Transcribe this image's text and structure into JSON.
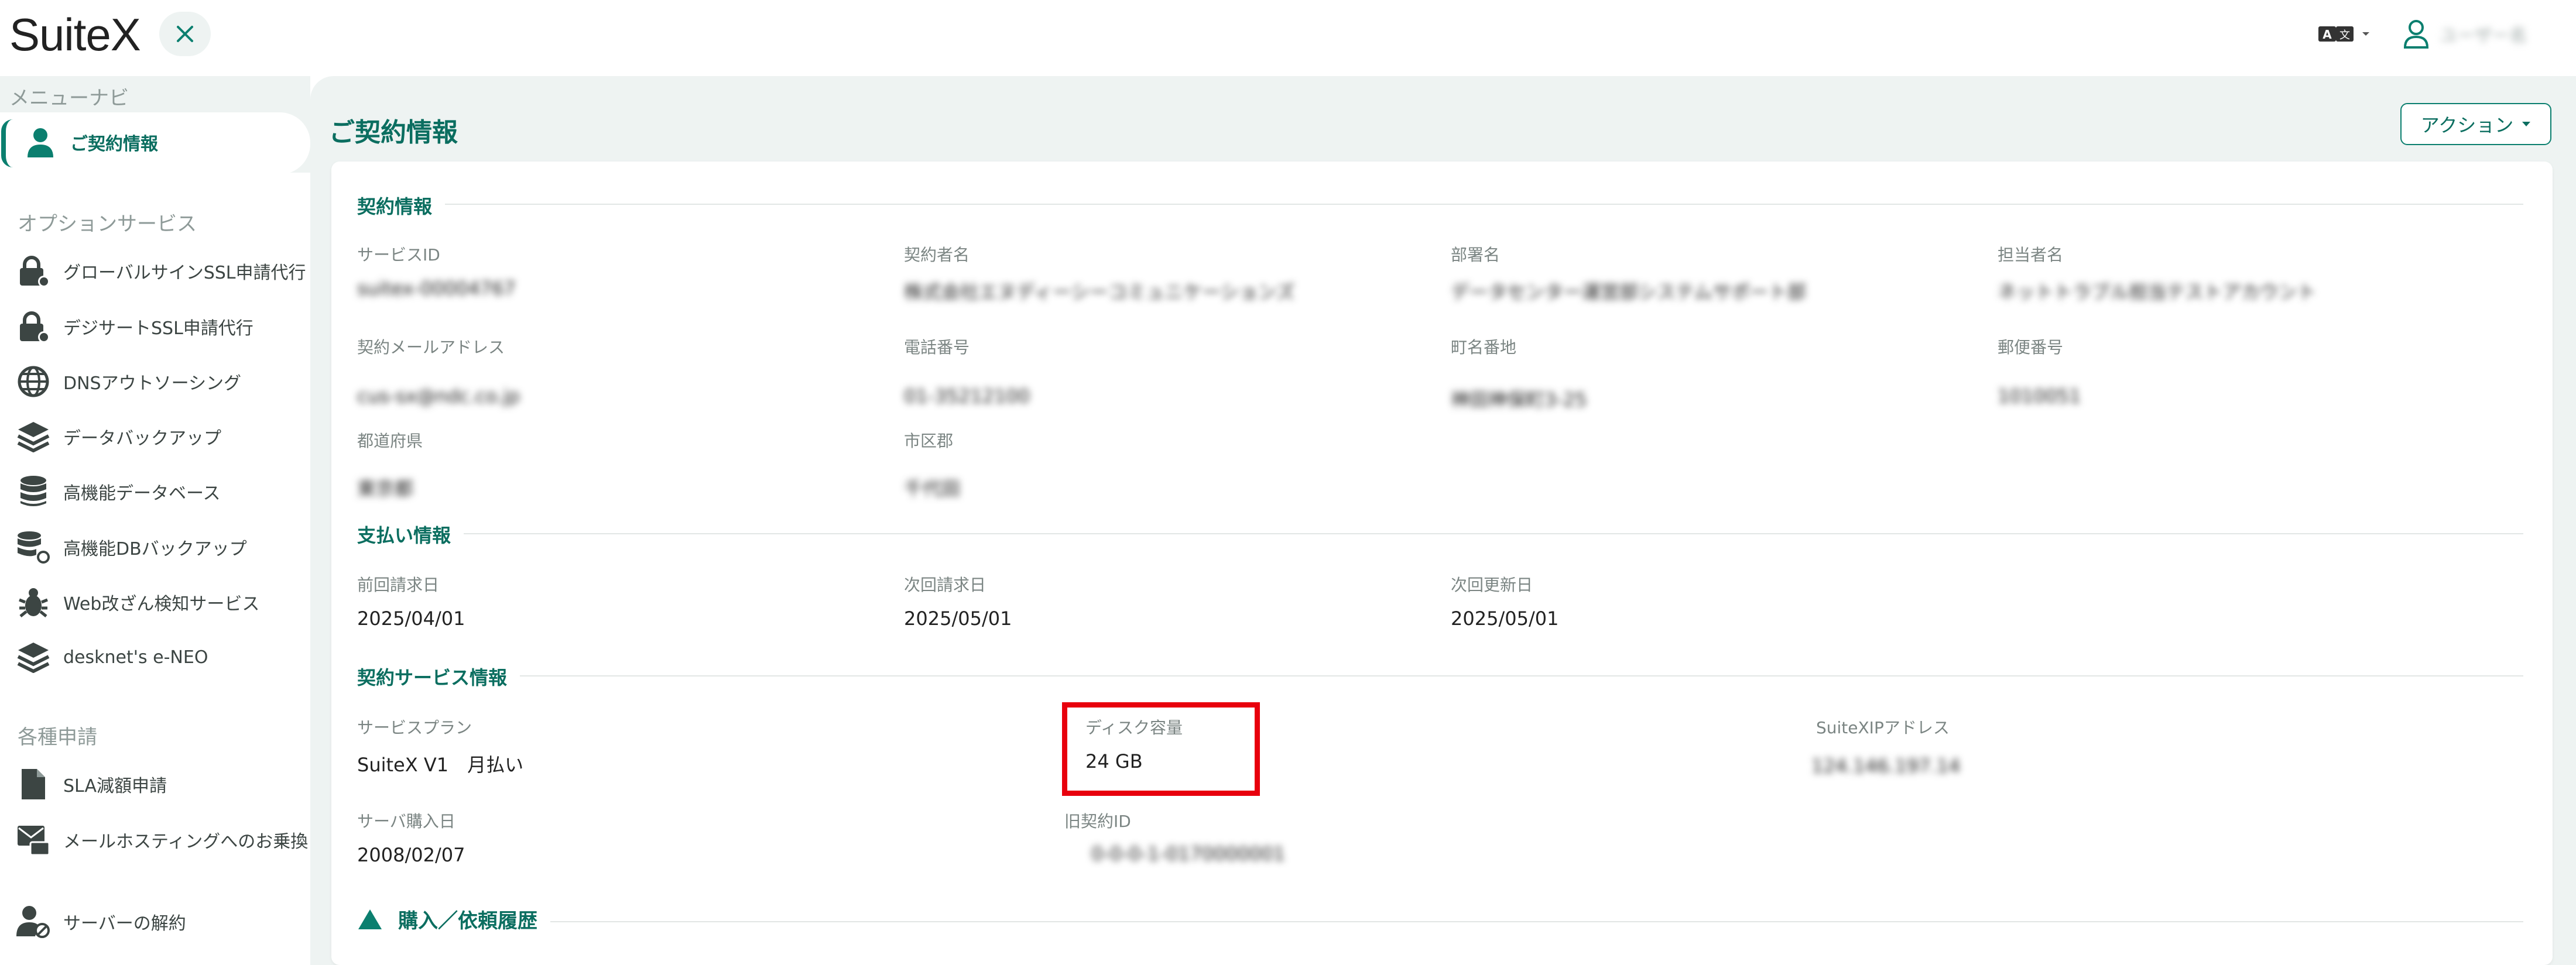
{
  "header": {
    "logo": "SuiteX",
    "user_name": "ユーザー名"
  },
  "sidebar": {
    "menu_heading": "メニューナビ",
    "active_item": "ご契約情報",
    "options_heading": "オプションサービス",
    "options": [
      {
        "label": "グローバルサインSSL申請代行",
        "icon": "lock-gear-icon"
      },
      {
        "label": "デジサートSSL申請代行",
        "icon": "lock-gear-icon"
      },
      {
        "label": "DNSアウトソーシング",
        "icon": "globe-icon"
      },
      {
        "label": "データバックアップ",
        "icon": "layers-icon"
      },
      {
        "label": "高機能データベース",
        "icon": "database-icon"
      },
      {
        "label": "高機能DBバックアップ",
        "icon": "database-refresh-icon"
      },
      {
        "label": "Web改ざん検知サービス",
        "icon": "bug-icon"
      },
      {
        "label": "desknet's e-NEO",
        "icon": "layers-icon"
      }
    ],
    "apps_heading": "各種申請",
    "apps": [
      {
        "label": "SLA減額申請",
        "icon": "file-icon"
      },
      {
        "label": "メールホスティングへのお乗換",
        "icon": "mail-transfer-icon"
      }
    ],
    "cancel": {
      "label": "サーバーの解約",
      "icon": "user-cancel-icon"
    }
  },
  "main": {
    "title": "ご契約情報",
    "action_label": "アクション",
    "contract_info": {
      "title": "契約情報",
      "fields": [
        {
          "label": "サービスID",
          "value": "suitex-00004767"
        },
        {
          "label": "契約者名",
          "value": "株式会社エヌディーシーコミュニケーションズ"
        },
        {
          "label": "部署名",
          "value": "データセンター運営部システムサポート部"
        },
        {
          "label": "担当者名",
          "value": "ネットトラブル担当テストアカウント"
        },
        {
          "label": "契約メールアドレス",
          "value": "cus-sx@ndc.co.jp"
        },
        {
          "label": "電話番号",
          "value": "01-35212100"
        },
        {
          "label": "町名番地",
          "value": "神田神保町3-25"
        },
        {
          "label": "郵便番号",
          "value": "1010051"
        },
        {
          "label": "都道府県",
          "value": "東京都"
        },
        {
          "label": "市区郡",
          "value": "千代田"
        }
      ]
    },
    "payment_info": {
      "title": "支払い情報",
      "fields": [
        {
          "label": "前回請求日",
          "value": "2025/04/01"
        },
        {
          "label": "次回請求日",
          "value": "2025/05/01"
        },
        {
          "label": "次回更新日",
          "value": "2025/05/01"
        }
      ]
    },
    "service_info": {
      "title": "契約サービス情報",
      "plan": {
        "label": "サービスプラン",
        "value": "SuiteX V1　月払い"
      },
      "disk": {
        "label": "ディスク容量",
        "value": "24 GB"
      },
      "ip": {
        "label": "SuiteXIPアドレス",
        "value": "124.146.197.14"
      },
      "purchase": {
        "label": "サーバ購入日",
        "value": "2008/02/07"
      },
      "old_id": {
        "label": "旧契約ID",
        "value": "0-0-0-1-0170000001"
      }
    },
    "history_label": "購入／依頼履歴"
  },
  "colors": {
    "accent": "#0b7f6f",
    "highlight": "#e8000d",
    "background": "#eef3f2"
  }
}
